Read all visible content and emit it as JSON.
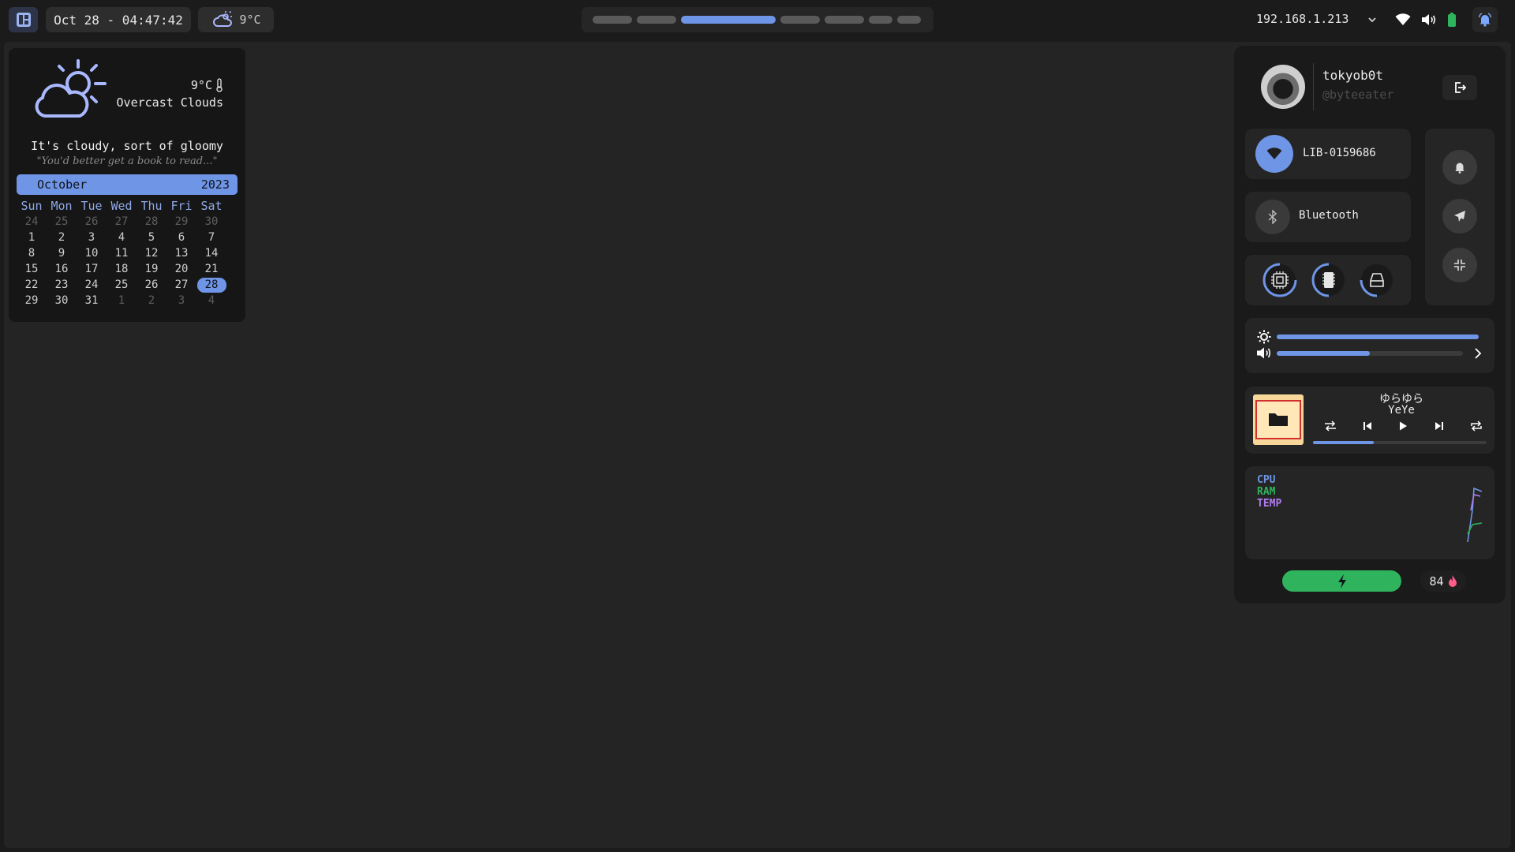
{
  "topbar": {
    "clock": "Oct 28 - 04:47:42",
    "weather_temp": "9°C",
    "workspaces": [
      {
        "active": false
      },
      {
        "active": false
      },
      {
        "active": true
      },
      {
        "active": false
      },
      {
        "active": false
      },
      {
        "active": false
      },
      {
        "active": false
      }
    ],
    "ip_address": "192.168.1.213"
  },
  "weather_widget": {
    "temperature": "9°C",
    "description": "Overcast Clouds",
    "message": "It's cloudy, sort of gloomy",
    "quote": "\"You'd better get a book to read...\""
  },
  "calendar": {
    "month": "October",
    "year": "2023",
    "weekdays": [
      "Sun",
      "Mon",
      "Tue",
      "Wed",
      "Thu",
      "Fri",
      "Sat"
    ],
    "weeks": [
      [
        "24",
        "25",
        "26",
        "27",
        "28",
        "29",
        "30"
      ],
      [
        "1",
        "2",
        "3",
        "4",
        "5",
        "6",
        "7"
      ],
      [
        "8",
        "9",
        "10",
        "11",
        "12",
        "13",
        "14"
      ],
      [
        "15",
        "16",
        "17",
        "18",
        "19",
        "20",
        "21"
      ],
      [
        "22",
        "23",
        "24",
        "25",
        "26",
        "27",
        "28"
      ],
      [
        "29",
        "30",
        "31",
        "1",
        "2",
        "3",
        "4"
      ]
    ],
    "today": "28"
  },
  "control_center": {
    "username": "tokyob0t",
    "handle": "@byteeater",
    "wifi_name": "LIB-0159686",
    "bluetooth_label": "Bluetooth",
    "brightness": 1.0,
    "volume": 0.5,
    "music": {
      "title": "ゆらゆら",
      "artist": "YeYe",
      "progress": 0.35
    },
    "monitor_labels": {
      "cpu": "CPU",
      "ram": "RAM",
      "temp": "TEMP"
    },
    "temperature_value": "84",
    "colors": {
      "accent": "#6f95e6",
      "battery": "#2fb35d",
      "cpu": "#6f95e6",
      "ram": "#2fb35d",
      "temp": "#b07cf0",
      "flame": "#ff5c8a"
    }
  }
}
